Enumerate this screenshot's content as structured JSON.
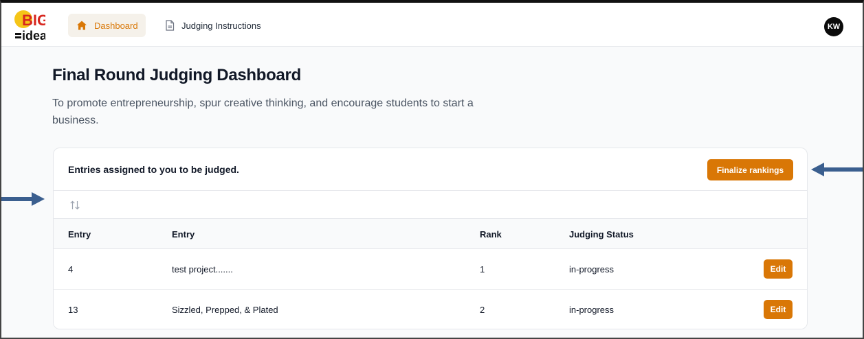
{
  "header": {
    "logo_text_top": "BIG",
    "logo_text_bottom": "idea",
    "nav": [
      {
        "label": "Dashboard",
        "icon": "home-icon",
        "active": true
      },
      {
        "label": "Judging Instructions",
        "icon": "document-icon",
        "active": false
      }
    ],
    "avatar_initials": "KW"
  },
  "page": {
    "title": "Final Round Judging Dashboard",
    "subtitle": "To promote entrepreneurship, spur creative thinking, and encourage students to start a business."
  },
  "card": {
    "title": "Entries assigned to you to be judged.",
    "finalize_label": "Finalize rankings",
    "sort_icon": "sort-arrows-icon",
    "columns": [
      "Entry",
      "Entry",
      "Rank",
      "Judging Status"
    ],
    "rows": [
      {
        "id": "4",
        "name": "test project.......",
        "rank": "1",
        "status": "in-progress",
        "action": "Edit"
      },
      {
        "id": "13",
        "name": "Sizzled, Prepped, & Plated",
        "rank": "2",
        "status": "in-progress",
        "action": "Edit"
      }
    ]
  },
  "colors": {
    "accent": "#d97706",
    "accent_bg": "#f5f1ea",
    "annotation_arrow": "#3b5f8f"
  }
}
